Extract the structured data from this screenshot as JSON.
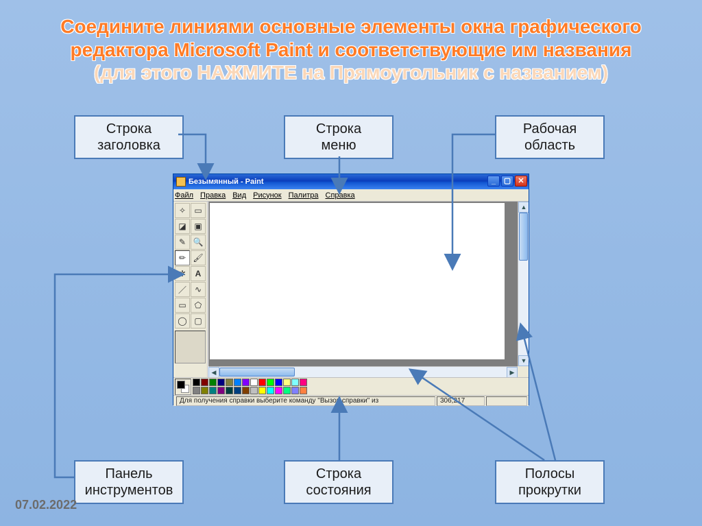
{
  "title": {
    "line1": "Соедините линиями основные элементы окна графического",
    "line2": "редактора Microsoft Paint и соответствующие им названия",
    "line3": "(для этого НАЖМИТЕ на Прямоугольник с названием)"
  },
  "labels": {
    "title_bar": "Строка\nзаголовка",
    "menu_bar": "Строка\nменю",
    "work_area": "Рабочая\nобласть",
    "toolbox": "Панель\nинструментов",
    "status_bar": "Строка\nсостояния",
    "scrollbars": "Полосы\nпрокрутки"
  },
  "date": "07.02.2022",
  "paint": {
    "title": "Безымянный - Paint",
    "menu": [
      "Файл",
      "Правка",
      "Вид",
      "Рисунок",
      "Палитра",
      "Справка"
    ],
    "status_msg": "Для получения справки выберите команду \"Вызов справки\" из",
    "status_coords": "306,217",
    "tools": [
      "free-select",
      "rect-select",
      "eraser",
      "fill",
      "picker",
      "magnify",
      "pencil",
      "brush",
      "airbrush",
      "text",
      "line",
      "curve",
      "rectangle",
      "polygon",
      "ellipse",
      "rounded-rect"
    ],
    "palette": [
      "#000000",
      "#808080",
      "#800000",
      "#808000",
      "#008000",
      "#008080",
      "#000080",
      "#800080",
      "#808040",
      "#004040",
      "#0080ff",
      "#004080",
      "#8000ff",
      "#804000",
      "#ffffff",
      "#c0c0c0",
      "#ff0000",
      "#ffff00",
      "#00ff00",
      "#00ffff",
      "#0000ff",
      "#ff00ff",
      "#ffff80",
      "#00ff80",
      "#80ffff",
      "#8080ff",
      "#ff0080",
      "#ff8040"
    ]
  },
  "arrows_color": "#4a7ab7"
}
